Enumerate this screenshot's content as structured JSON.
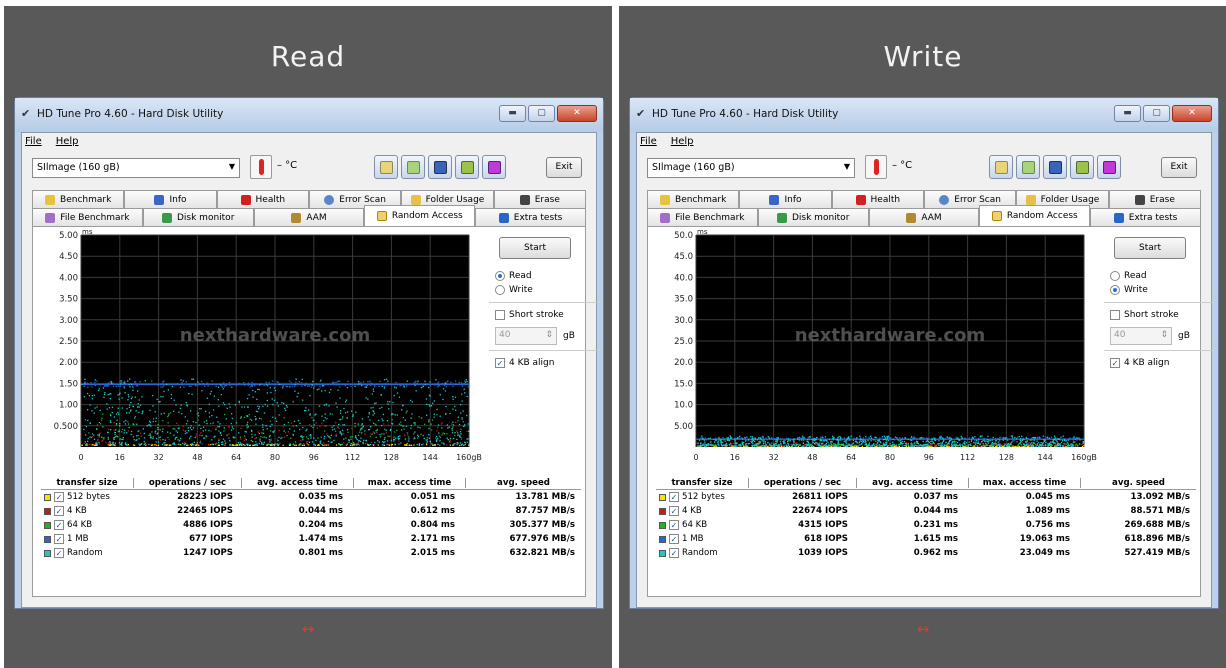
{
  "panels": [
    {
      "heading": "Read",
      "window_title": "HD Tune Pro 4.60 - Hard Disk Utility",
      "menu": [
        "File",
        "Help"
      ],
      "drive": "SIlmage  (160 gB)",
      "temp": "– °C",
      "exit": "Exit",
      "tabs_top": [
        "Benchmark",
        "Info",
        "Health",
        "Error Scan",
        "Folder Usage",
        "Erase"
      ],
      "tabs_bottom": [
        "File Benchmark",
        "Disk monitor",
        "AAM",
        "Random Access",
        "Extra tests"
      ],
      "start": "Start",
      "mode_read": "Read",
      "mode_write": "Write",
      "selected_mode": "Read",
      "short_stroke": "Short stroke",
      "stroke_value": "40",
      "stroke_unit": "gB",
      "align": "4 KB align",
      "watermark": "nexthardware.com",
      "table_headers": [
        "transfer size",
        "operations / sec",
        "avg. access time",
        "max. access time",
        "avg. speed"
      ],
      "rows": [
        {
          "size": "512 bytes",
          "ops": "28223 IOPS",
          "avg": "0.035 ms",
          "max": "0.051 ms",
          "speed": "13.781 MB/s",
          "color": "#f2e600"
        },
        {
          "size": "4 KB",
          "ops": "22465 IOPS",
          "avg": "0.044 ms",
          "max": "0.612 ms",
          "speed": "87.757 MB/s",
          "color": "#c41a1a"
        },
        {
          "size": "64 KB",
          "ops": "4886 IOPS",
          "avg": "0.204 ms",
          "max": "0.804 ms",
          "speed": "305.377 MB/s",
          "color": "#1fb31f"
        },
        {
          "size": "1 MB",
          "ops": "677 IOPS",
          "avg": "1.474 ms",
          "max": "2.171 ms",
          "speed": "677.976 MB/s",
          "color": "#2a66d0"
        },
        {
          "size": "Random",
          "ops": "1247 IOPS",
          "avg": "0.801 ms",
          "max": "2.015 ms",
          "speed": "632.821 MB/s",
          "color": "#21c7c7"
        }
      ],
      "arrow": "↔"
    },
    {
      "heading": "Write",
      "window_title": "HD Tune Pro 4.60 - Hard Disk Utility",
      "menu": [
        "File",
        "Help"
      ],
      "drive": "SIlmage  (160 gB)",
      "temp": "– °C",
      "exit": "Exit",
      "tabs_top": [
        "Benchmark",
        "Info",
        "Health",
        "Error Scan",
        "Folder Usage",
        "Erase"
      ],
      "tabs_bottom": [
        "File Benchmark",
        "Disk monitor",
        "AAM",
        "Random Access",
        "Extra tests"
      ],
      "start": "Start",
      "mode_read": "Read",
      "mode_write": "Write",
      "selected_mode": "Write",
      "short_stroke": "Short stroke",
      "stroke_value": "40",
      "stroke_unit": "gB",
      "align": "4 KB align",
      "watermark": "nexthardware.com",
      "table_headers": [
        "transfer size",
        "operations / sec",
        "avg. access time",
        "max. access time",
        "avg. speed"
      ],
      "rows": [
        {
          "size": "512 bytes",
          "ops": "26811 IOPS",
          "avg": "0.037 ms",
          "max": "0.045 ms",
          "speed": "13.092 MB/s",
          "color": "#f2e600"
        },
        {
          "size": "4 KB",
          "ops": "22674 IOPS",
          "avg": "0.044 ms",
          "max": "1.089 ms",
          "speed": "88.571 MB/s",
          "color": "#c41a1a"
        },
        {
          "size": "64 KB",
          "ops": "4315 IOPS",
          "avg": "0.231 ms",
          "max": "0.756 ms",
          "speed": "269.688 MB/s",
          "color": "#1fb31f"
        },
        {
          "size": "1 MB",
          "ops": "618 IOPS",
          "avg": "1.615 ms",
          "max": "19.063 ms",
          "speed": "618.896 MB/s",
          "color": "#2a66d0"
        },
        {
          "size": "Random",
          "ops": "1039 IOPS",
          "avg": "0.962 ms",
          "max": "23.049 ms",
          "speed": "527.419 MB/s",
          "color": "#21c7c7"
        }
      ],
      "arrow": "↔"
    }
  ],
  "chart_data": [
    {
      "type": "scatter",
      "ylabel": "ms",
      "y_ticks": [
        "5.00",
        "4.50",
        "4.00",
        "3.50",
        "3.00",
        "2.50",
        "2.00",
        "1.50",
        "1.00",
        "0.500"
      ],
      "x_ticks": [
        "0",
        "16",
        "32",
        "48",
        "64",
        "80",
        "96",
        "112",
        "128",
        "144",
        "160gB"
      ],
      "xlim": [
        0,
        160
      ],
      "ylim": [
        0,
        5
      ],
      "series": [
        {
          "name": "512 bytes",
          "band": [
            0.03,
            0.05
          ],
          "color": "#f2e600"
        },
        {
          "name": "4 KB",
          "band": [
            0.04,
            0.6
          ],
          "color": "#c41a1a"
        },
        {
          "name": "64 KB",
          "band": [
            0.2,
            0.8
          ],
          "color": "#1fb31f"
        },
        {
          "name": "1 MB",
          "band": [
            1.4,
            1.55
          ],
          "color": "#2a66d0"
        },
        {
          "name": "Random",
          "band": [
            0.05,
            1.6
          ],
          "color": "#21c7c7"
        }
      ]
    },
    {
      "type": "scatter",
      "ylabel": "ms",
      "y_ticks": [
        "50.0",
        "45.0",
        "40.0",
        "35.0",
        "30.0",
        "25.0",
        "20.0",
        "15.0",
        "10.0",
        "5.00"
      ],
      "x_ticks": [
        "0",
        "16",
        "32",
        "48",
        "64",
        "80",
        "96",
        "112",
        "128",
        "144",
        "160gB"
      ],
      "xlim": [
        0,
        160
      ],
      "ylim": [
        0,
        50
      ],
      "series": [
        {
          "name": "512 bytes",
          "band": [
            0.03,
            0.05
          ],
          "color": "#f2e600"
        },
        {
          "name": "4 KB",
          "band": [
            0.04,
            1.0
          ],
          "color": "#c41a1a"
        },
        {
          "name": "64 KB",
          "band": [
            0.2,
            0.8
          ],
          "color": "#1fb31f"
        },
        {
          "name": "1 MB",
          "band": [
            1.5,
            2.2
          ],
          "color": "#2a66d0"
        },
        {
          "name": "Random",
          "band": [
            0.1,
            2.5
          ],
          "color": "#21c7c7"
        }
      ]
    }
  ]
}
